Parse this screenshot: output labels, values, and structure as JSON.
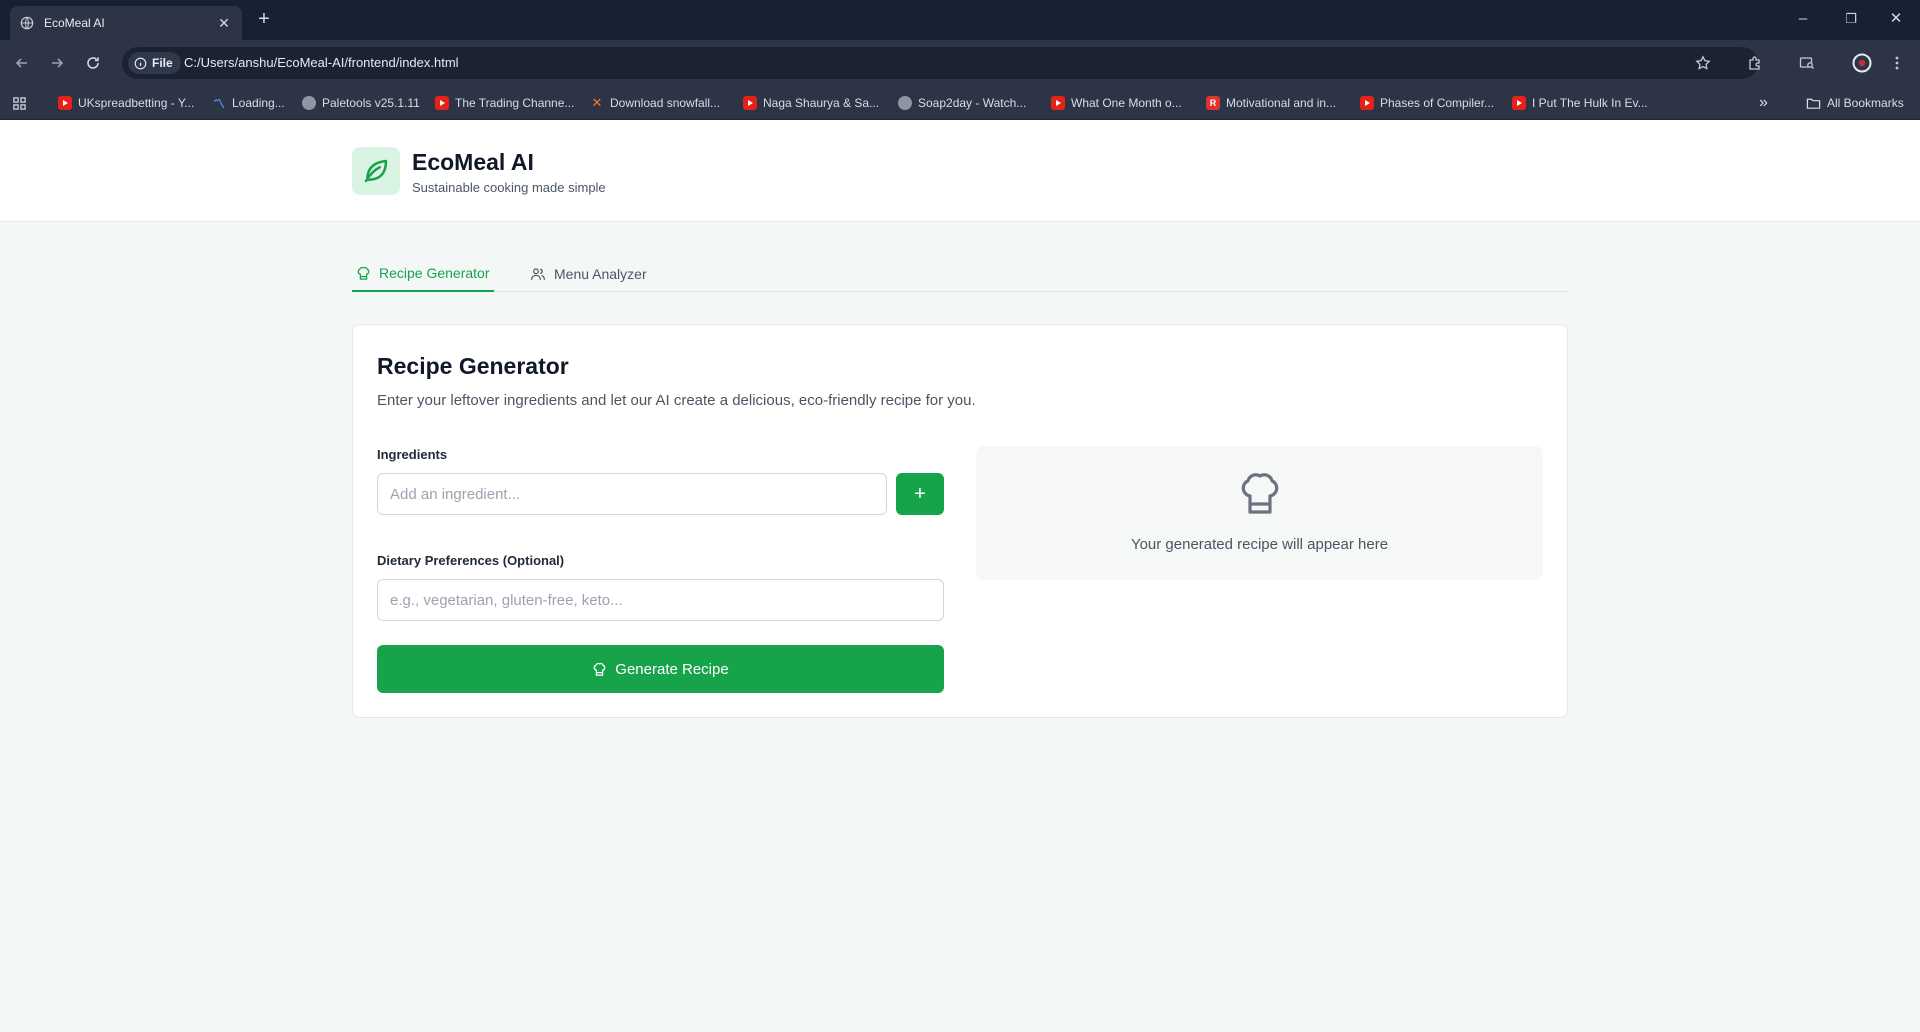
{
  "browser": {
    "tab_title": "EcoMeal AI",
    "tab_close": "✕",
    "new_tab": "+",
    "window_controls": {
      "minimize": "–",
      "restore": "❐",
      "close": "✕"
    },
    "address": {
      "chip_label": "File",
      "url": "C:/Users/anshu/EcoMeal-AI/frontend/index.html"
    },
    "bookmarks": [
      {
        "label": "UKspreadbetting - Y...",
        "icon": "youtube-icon"
      },
      {
        "label": "Loading...",
        "icon": "pulse-icon"
      },
      {
        "label": "Paletools v25.1.11",
        "icon": "globe-icon"
      },
      {
        "label": "The Trading Channe...",
        "icon": "youtube-icon"
      },
      {
        "label": "Download snowfall...",
        "icon": "x-icon"
      },
      {
        "label": "Naga Shaurya & Sa...",
        "icon": "youtube-icon"
      },
      {
        "label": "Soap2day - Watch...",
        "icon": "globe-icon"
      },
      {
        "label": "What One Month o...",
        "icon": "youtube-icon"
      },
      {
        "label": "Motivational and in...",
        "icon": "r-icon",
        "glyph": "R"
      },
      {
        "label": "Phases of Compiler...",
        "icon": "youtube-icon"
      },
      {
        "label": "I Put The Hulk In Ev...",
        "icon": "youtube-icon"
      }
    ],
    "overflow": "»",
    "all_bookmarks": "All Bookmarks"
  },
  "app": {
    "title": "EcoMeal AI",
    "subtitle": "Sustainable cooking made simple",
    "brand_color": "#16a34a",
    "tabs": [
      {
        "label": "Recipe Generator",
        "icon": "chef-hat-icon",
        "active": true
      },
      {
        "label": "Menu Analyzer",
        "icon": "users-icon",
        "active": false
      }
    ]
  },
  "generator": {
    "title": "Recipe Generator",
    "description": "Enter your leftover ingredients and let our AI create a delicious, eco-friendly recipe for you.",
    "ingredients_label": "Ingredients",
    "ingredients_placeholder": "Add an ingredient...",
    "add_button": "+",
    "dietary_label": "Dietary Preferences (Optional)",
    "dietary_placeholder": "e.g., vegetarian, gluten-free, keto...",
    "generate_button": "Generate Recipe",
    "empty_state": "Your generated recipe will appear here"
  }
}
